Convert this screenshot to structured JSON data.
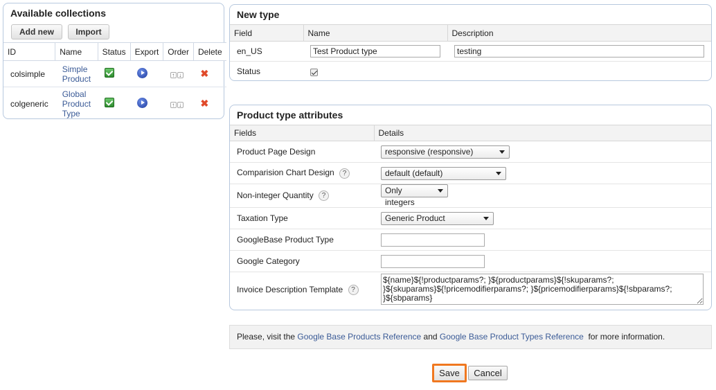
{
  "collections": {
    "title": "Available collections",
    "add_new_label": "Add new",
    "import_label": "Import",
    "columns": [
      "ID",
      "Name",
      "Status",
      "Export",
      "Order",
      "Delete"
    ],
    "rows": [
      {
        "id": "colsimple",
        "name_lines": [
          "Simple",
          "Product"
        ]
      },
      {
        "id": "colgeneric",
        "name_lines": [
          "Global",
          "Product",
          "Type"
        ]
      }
    ]
  },
  "new_type": {
    "title": "New type",
    "columns": [
      "Field",
      "Name",
      "Description"
    ],
    "locale_label": "en_US",
    "name_value": "Test Product type",
    "description_value": "testing",
    "status_label": "Status",
    "status_checked": true
  },
  "attributes": {
    "title": "Product type attributes",
    "columns": [
      "Fields",
      "Details"
    ],
    "product_page_design": {
      "label": "Product Page Design",
      "value": "responsive (responsive)"
    },
    "comparison_chart_design": {
      "label": "Comparision Chart Design",
      "value": "default (default)"
    },
    "non_integer_quantity": {
      "label": "Non-integer Quantity",
      "value": "Only integers"
    },
    "taxation_type": {
      "label": "Taxation Type",
      "value": "Generic Product"
    },
    "googlebase_product_type": {
      "label": "GoogleBase Product Type",
      "value": ""
    },
    "google_category": {
      "label": "Google Category",
      "value": ""
    },
    "invoice_description_template": {
      "label": "Invoice Description Template",
      "value": "${name}${!productparams?; }${productparams}${!skuparams?; }${skuparams}${!pricemodifierparams?; }${pricemodifierparams}${!sbparams?; }${sbparams}"
    },
    "help_glyph": "?"
  },
  "info": {
    "prefix": "Please, visit the",
    "link1": "Google Base Products Reference",
    "middle": "and",
    "link2": "Google Base Product Types Reference",
    "suffix": "for more information."
  },
  "actions": {
    "save_label": "Save",
    "cancel_label": "Cancel"
  },
  "colors": {
    "accent_link": "#3a5a96",
    "panel_border": "#b7c8de",
    "save_highlight": "#f07820"
  }
}
